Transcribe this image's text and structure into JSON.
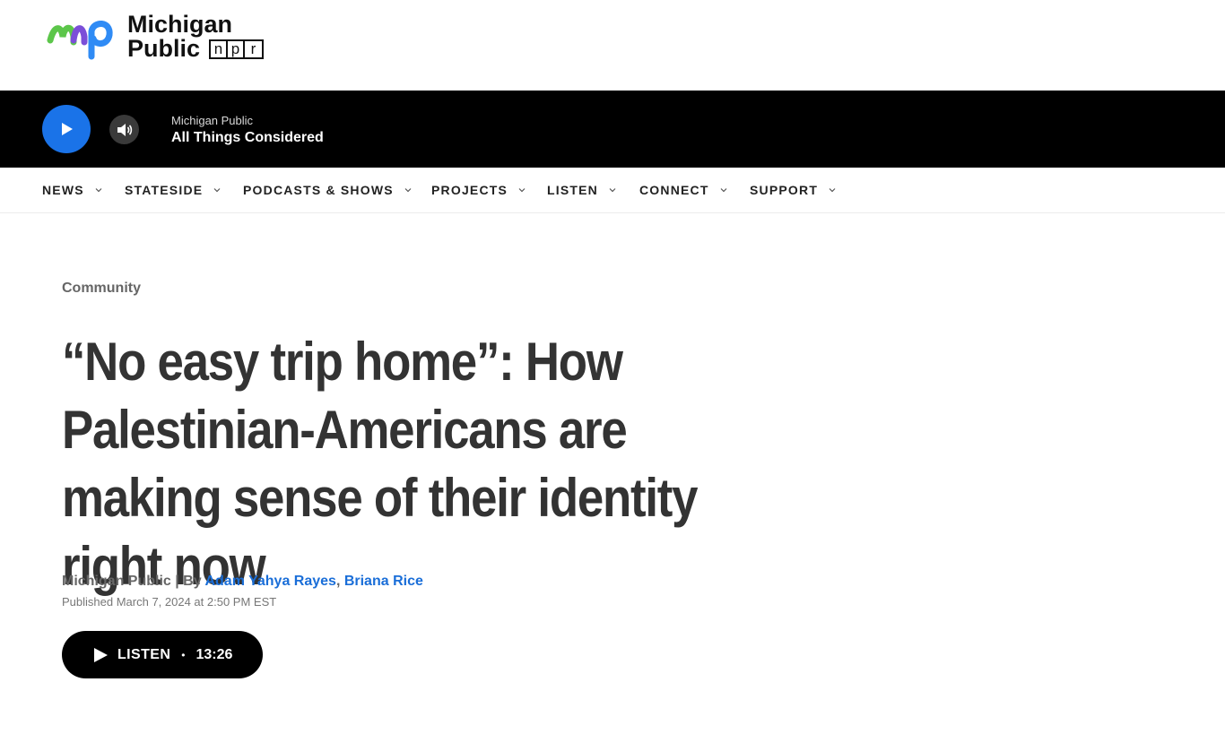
{
  "header": {
    "logo_line1": "Michigan",
    "logo_line2": "Public",
    "npr_letters": [
      "n",
      "p",
      "r"
    ],
    "faded_text": "...",
    "colors": {
      "logo_green": "#5cc64a",
      "logo_purple": "#7b4fd8",
      "logo_blue": "#2f8bf5"
    }
  },
  "player": {
    "station": "Michigan Public",
    "show": "All Things Considered",
    "play_icon": "play-icon",
    "volume_icon": "volume-icon",
    "accent": "#1a73e8"
  },
  "nav": {
    "items": [
      {
        "label": "NEWS"
      },
      {
        "label": "STATESIDE"
      },
      {
        "label": "PODCASTS & SHOWS"
      },
      {
        "label": "PROJECTS"
      },
      {
        "label": "LISTEN"
      },
      {
        "label": "CONNECT"
      },
      {
        "label": "SUPPORT"
      }
    ]
  },
  "article": {
    "kicker": "Community",
    "headline": "“No easy trip home”: How Palestinian-Americans are making sense of their identity right now",
    "byline_source": "Michigan Public | By ",
    "authors": [
      "Adam Yahya Rayes",
      "Briana Rice"
    ],
    "author_sep": ", ",
    "published": "Published March 7, 2024 at 2:50 PM EST",
    "listen": {
      "label": "LISTEN",
      "dot": "•",
      "duration": "13:26"
    }
  }
}
